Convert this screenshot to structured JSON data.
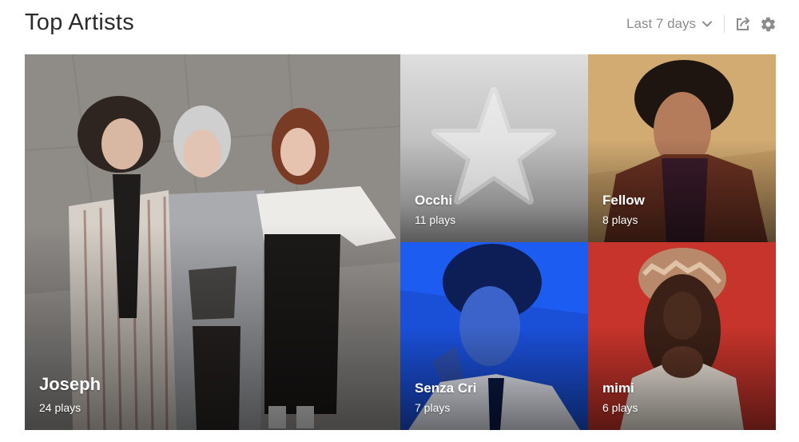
{
  "header": {
    "title": "Top Artists",
    "range_label": "Last 7 days",
    "icons": {
      "range": "chevron-down-icon",
      "share": "share-icon",
      "settings": "gear-icon"
    }
  },
  "artists": [
    {
      "name": "Joseph",
      "plays": "24 plays"
    },
    {
      "name": "Occhi",
      "plays": "11 plays"
    },
    {
      "name": "Fellow",
      "plays": "8 plays"
    },
    {
      "name": "Senza Cri",
      "plays": "7 plays"
    },
    {
      "name": "mimi",
      "plays": "6 plays"
    }
  ],
  "colors": {
    "title": "#2b2b2b",
    "muted": "#8c8c8c",
    "placeholder_bg": "#c2c2c2",
    "senza_bg": "#1a4fd8",
    "mimi_bg": "#c7342b",
    "fellow_bg": "#c9a26a"
  }
}
